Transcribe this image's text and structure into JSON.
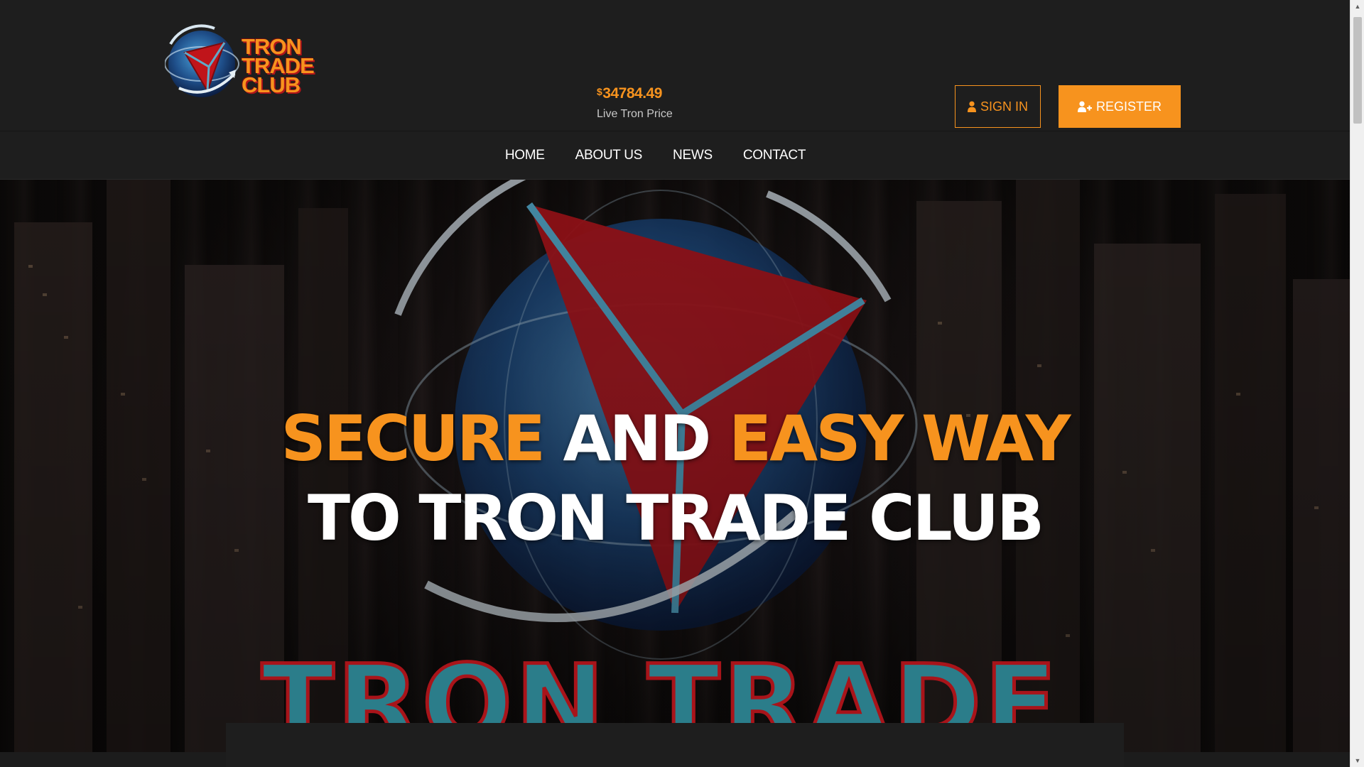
{
  "header": {
    "logo": {
      "lines": [
        "TRON",
        "TRADE",
        "CLUB"
      ]
    },
    "price": {
      "currency": "$",
      "value": "34784.49",
      "label": "Live Tron Price"
    },
    "signin_label": "SIGN IN",
    "register_label": "REGISTER"
  },
  "nav": {
    "items": [
      {
        "label": "HOME"
      },
      {
        "label": "ABOUT US"
      },
      {
        "label": "NEWS"
      },
      {
        "label": "CONTACT"
      }
    ]
  },
  "hero": {
    "line1": {
      "part1": "SECURE",
      "part2": "AND",
      "part3": "EASY WAY"
    },
    "line2": "TO TRON TRADE CLUB",
    "background_text": "TRON TRADE"
  },
  "colors": {
    "accent": "#f7931e",
    "header_bg": "#1e1e1e",
    "logo_red": "#c0141a",
    "globe_blue": "#1f4f8a"
  },
  "icons": {
    "signin": "user-icon",
    "register": "user-plus-icon",
    "logo": "tron-globe-icon"
  }
}
